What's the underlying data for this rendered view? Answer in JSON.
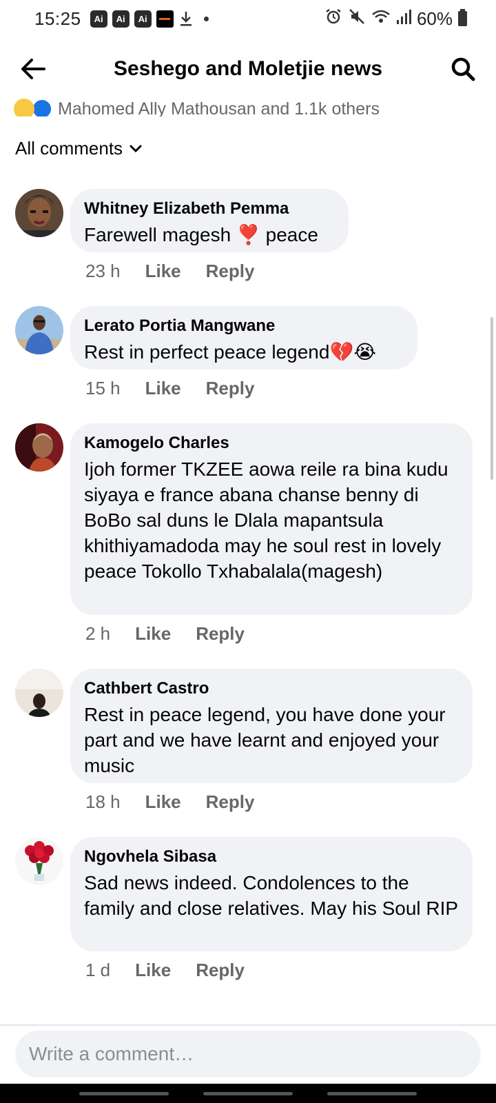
{
  "status_bar": {
    "time": "15:25",
    "ai_badges": [
      "Ai",
      "Ai",
      "Ai"
    ],
    "battery": "60%"
  },
  "header": {
    "title": "Seshego and Moletjie news"
  },
  "reactions": {
    "text": "Mahomed Ally Mathousan and 1.1k others"
  },
  "sort": {
    "label": "All comments"
  },
  "comments": [
    {
      "author": "Whitney Elizabeth Pemma",
      "text": "Farewell magesh ❣️ peace",
      "time": "23 h",
      "like": "Like",
      "reply": "Reply"
    },
    {
      "author": "Lerato Portia Mangwane",
      "text": "Rest in perfect  peace legend💔😭",
      "time": "15 h",
      "like": "Like",
      "reply": "Reply"
    },
    {
      "author": "Kamogelo Charles",
      "text": "Ijoh former TKZEE aowa reile ra bina kudu siyaya e france abana chanse benny di BoBo sal duns le Dlala mapantsula khithiyamadoda may he soul rest in lovely peace Tokollo Txhabalala(magesh)",
      "time": "2 h",
      "like": "Like",
      "reply": "Reply"
    },
    {
      "author": "Cathbert Castro",
      "text": "Rest in peace legend, you have done your part and we have learnt and enjoyed your music",
      "time": "18 h",
      "like": "Like",
      "reply": "Reply"
    },
    {
      "author": "Ngovhela Sibasa",
      "text": "Sad news indeed. Condolences  to the family  and  close  relatives. May his Soul RIP",
      "time": "1 d",
      "like": "Like",
      "reply": "Reply"
    }
  ],
  "composer": {
    "placeholder": "Write a comment…"
  },
  "colors": {
    "bubble": "#f0f2f5",
    "meta": "#65676b",
    "like_reaction": "#1b74e4",
    "sad_reaction": "#f7c843"
  },
  "icons": {
    "back": "arrow-left-icon",
    "search": "search-icon",
    "sort": "chevron-down-icon"
  }
}
